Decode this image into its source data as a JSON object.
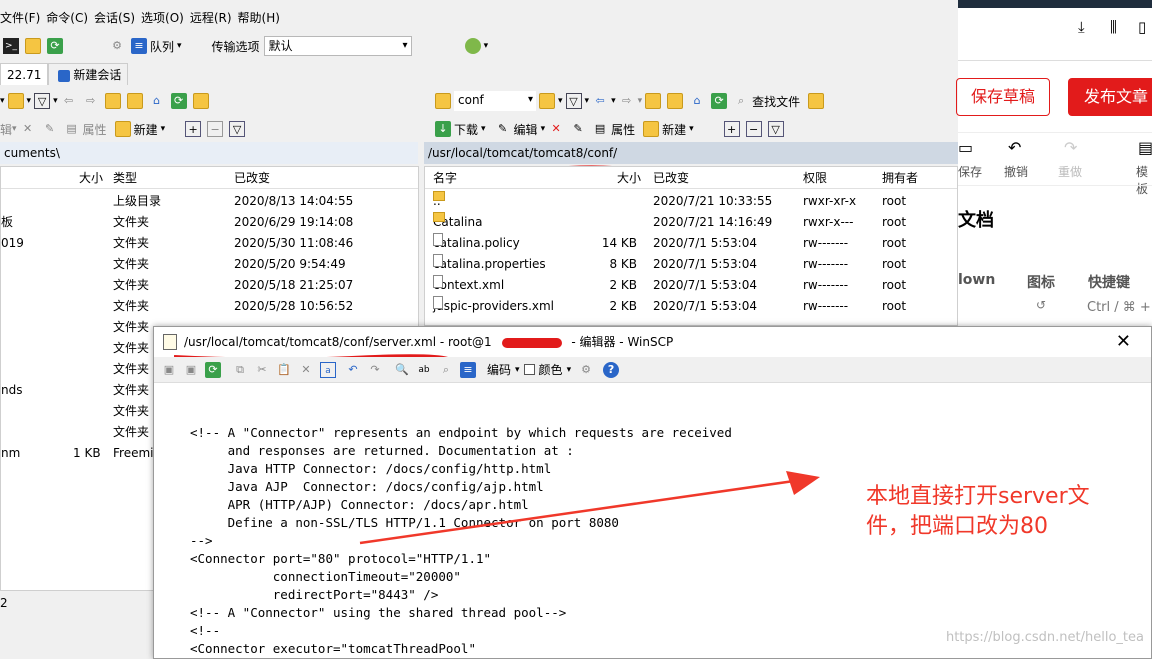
{
  "menu": [
    "文件(F)",
    "命令(C)",
    "会话(S)",
    "选项(O)",
    "远程(R)",
    "帮助(H)"
  ],
  "toolbar1": {
    "queue_label": "队列",
    "transfer_label": "传输选项",
    "transfer_value": "默认"
  },
  "tabs": {
    "session_tab": "22.71",
    "new_session": "新建会话"
  },
  "left": {
    "toolbar_new": "新建",
    "toolbar_props": "属性",
    "path": "cuments\\",
    "cols": {
      "size": "大小",
      "type": "类型",
      "changed": "已改变"
    },
    "rows": [
      {
        "name": "",
        "size": "",
        "type": "上级目录",
        "changed": "2020/8/13  14:04:55"
      },
      {
        "name": "板",
        "size": "",
        "type": "文件夹",
        "changed": "2020/6/29  19:14:08"
      },
      {
        "name": "019",
        "size": "",
        "type": "文件夹",
        "changed": "2020/5/30  11:08:46"
      },
      {
        "name": "",
        "size": "",
        "type": "文件夹",
        "changed": "2020/5/20   9:54:49"
      },
      {
        "name": "",
        "size": "",
        "type": "文件夹",
        "changed": "2020/5/18  21:25:07"
      },
      {
        "name": "",
        "size": "",
        "type": "文件夹",
        "changed": "2020/5/28  10:56:52"
      },
      {
        "name": "",
        "size": "",
        "type": "文件夹",
        "changed": ""
      },
      {
        "name": "",
        "size": "",
        "type": "文件夹",
        "changed": ""
      },
      {
        "name": "",
        "size": "",
        "type": "文件夹",
        "changed": ""
      },
      {
        "name": "nds",
        "size": "",
        "type": "文件夹",
        "changed": ""
      },
      {
        "name": "",
        "size": "",
        "type": "文件夹",
        "changed": ""
      },
      {
        "name": "",
        "size": "",
        "type": "文件夹",
        "changed": ""
      },
      {
        "name": "nm",
        "size": "1 KB",
        "type": "Freemi",
        "changed": ""
      }
    ],
    "status": "2"
  },
  "right": {
    "combo": "conf",
    "find_files": "查找文件",
    "download": "下载",
    "edit": "编辑",
    "props": "属性",
    "new": "新建",
    "path": "/usr/local/tomcat/tomcat8/conf/",
    "cols": {
      "name": "名字",
      "size": "大小",
      "changed": "已改变",
      "perms": "权限",
      "owner": "拥有者"
    },
    "rows": [
      {
        "name": "..",
        "size": "",
        "changed": "2020/7/21 10:33:55",
        "perms": "rwxr-xr-x",
        "owner": "root",
        "dir": true
      },
      {
        "name": "Catalina",
        "size": "",
        "changed": "2020/7/21 14:16:49",
        "perms": "rwxr-x---",
        "owner": "root",
        "dir": true
      },
      {
        "name": "catalina.policy",
        "size": "14 KB",
        "changed": "2020/7/1 5:53:04",
        "perms": "rw-------",
        "owner": "root",
        "dir": false
      },
      {
        "name": "catalina.properties",
        "size": "8 KB",
        "changed": "2020/7/1 5:53:04",
        "perms": "rw-------",
        "owner": "root",
        "dir": false
      },
      {
        "name": "context.xml",
        "size": "2 KB",
        "changed": "2020/7/1 5:53:04",
        "perms": "rw-------",
        "owner": "root",
        "dir": false
      },
      {
        "name": "jaspic-providers.xml",
        "size": "2 KB",
        "changed": "2020/7/1 5:53:04",
        "perms": "rw-------",
        "owner": "root",
        "dir": false
      }
    ]
  },
  "editor": {
    "title": "/usr/local/tomcat/tomcat8/conf/server.xml - root@1",
    "title_suffix": "- 编辑器 - WinSCP",
    "encoding": "编码",
    "color": "颜色",
    "code": "<!-- A \"Connector\" represents an endpoint by which requests are received\n     and responses are returned. Documentation at :\n     Java HTTP Connector: /docs/config/http.html\n     Java AJP  Connector: /docs/config/ajp.html\n     APR (HTTP/AJP) Connector: /docs/apr.html\n     Define a non-SSL/TLS HTTP/1.1 Connector on port 8080\n-->\n<Connector port=\"80\" protocol=\"HTTP/1.1\"\n           connectionTimeout=\"20000\"\n           redirectPort=\"8443\" />\n<!-- A \"Connector\" using the shared thread pool-->\n<!--\n<Connector executor=\"tomcatThreadPool\""
  },
  "browser": {
    "save_draft": "保存草稿",
    "publish": "发布文章",
    "save": "保存",
    "undo": "撤销",
    "redo": "重做",
    "template": "模板",
    "doc_heading": "文档",
    "down_label": "lown",
    "icon_col": "图标",
    "shortcut_col": "快捷键",
    "shortcut_val": "Ctrl / ⌘ +"
  },
  "annotation": "本地直接打开server文件，把端口改为80",
  "watermark": "https://blog.csdn.net/hello_tea",
  "colors": {
    "accent_red": "#e21b1b",
    "annotation": "#f0382a",
    "path_bar": "#cfd8e3"
  }
}
